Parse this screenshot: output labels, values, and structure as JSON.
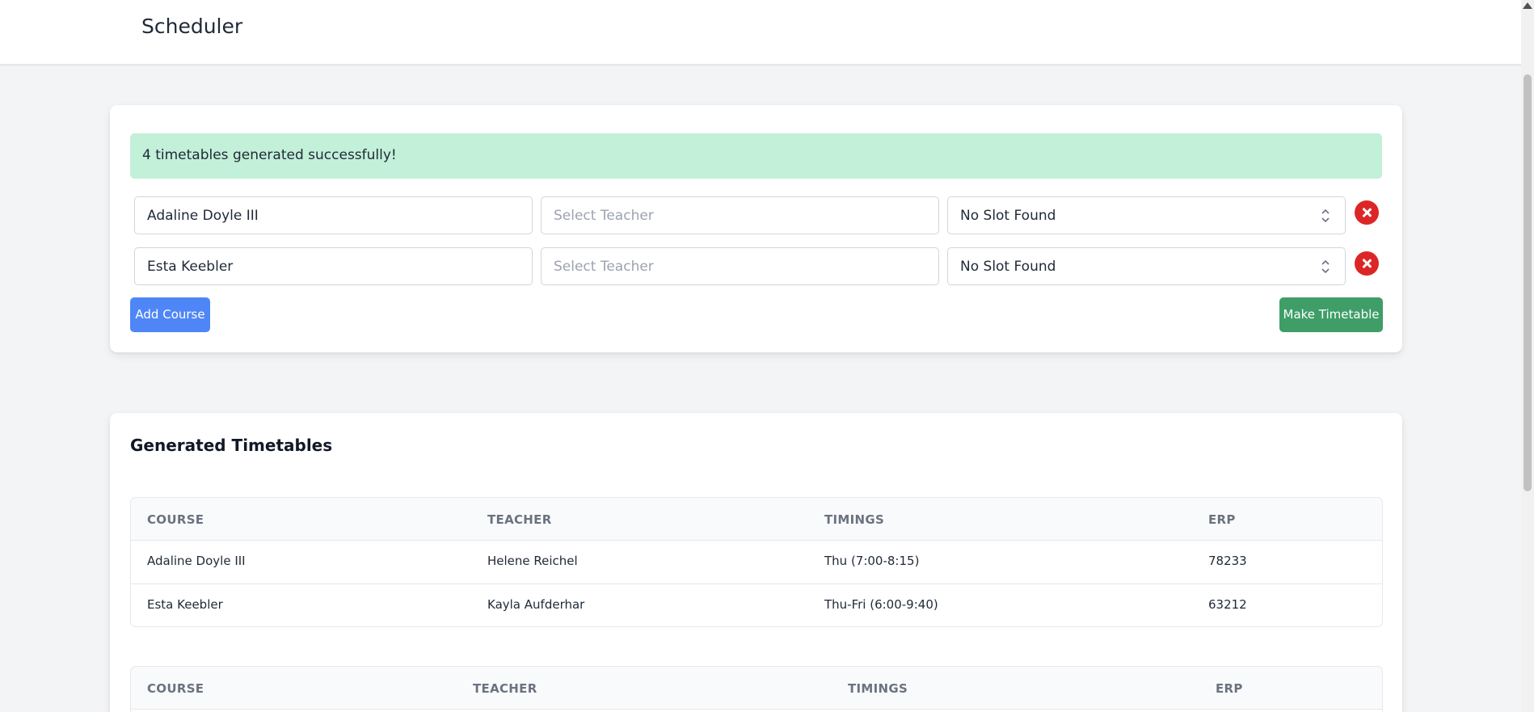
{
  "navbar": {
    "brand": "Scheduler"
  },
  "alert": {
    "message": "4 timetables generated successfully!"
  },
  "courses": [
    {
      "course": "Adaline Doyle III",
      "teacher_placeholder": "Select Teacher",
      "slot": "No Slot Found"
    },
    {
      "course": "Esta Keebler",
      "teacher_placeholder": "Select Teacher",
      "slot": "No Slot Found"
    }
  ],
  "buttons": {
    "add_course": "Add Course",
    "make_timetable": "Make Timetable"
  },
  "results": {
    "title": "Generated Timetables",
    "columns": [
      "COURSE",
      "TEACHER",
      "TIMINGS",
      "ERP"
    ],
    "timetables": [
      {
        "rows": [
          {
            "course": "Adaline Doyle III",
            "teacher": "Helene Reichel",
            "timings": "Thu (7:00-8:15)",
            "erp": "78233"
          },
          {
            "course": "Esta Keebler",
            "teacher": "Kayla Aufderhar",
            "timings": "Thu-Fri (6:00-9:40)",
            "erp": "63212"
          }
        ]
      },
      {
        "rows": []
      }
    ]
  },
  "colors": {
    "alert_bg": "#c3f0d8",
    "primary": "#4f86f7",
    "success": "#3f9e68",
    "danger": "#dc2626"
  },
  "icons": {
    "remove": "close-circle-icon",
    "select": "chevron-up-down-icon"
  }
}
